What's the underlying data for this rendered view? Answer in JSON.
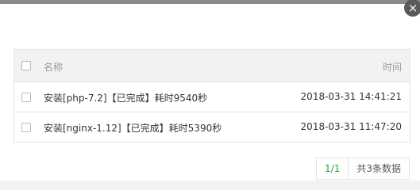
{
  "table": {
    "header": {
      "name": "名称",
      "time": "时间"
    },
    "rows": [
      {
        "name": "安装[php-7.2]【已完成】耗时9540秒",
        "time": "2018-03-31 14:41:21"
      },
      {
        "name": "安装[nginx-1.12]【已完成】耗时5390秒",
        "time": "2018-03-31 11:47:20"
      }
    ]
  },
  "pagination": {
    "current": "1/1",
    "total": "共3条数据"
  },
  "close_icon": "×",
  "colors": {
    "accent": "#20a53a"
  }
}
